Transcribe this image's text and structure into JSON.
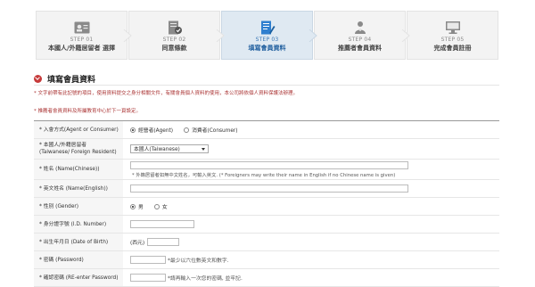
{
  "steps": [
    {
      "num": "STEP 01",
      "label": "本國人/外籍居留者  選擇",
      "icon": "id-card-icon",
      "active": false
    },
    {
      "num": "STEP 02",
      "label": "同意條款",
      "icon": "checklist-icon",
      "active": false
    },
    {
      "num": "STEP 03",
      "label": "填寫會員資料",
      "icon": "edit-form-icon",
      "active": true
    },
    {
      "num": "STEP 04",
      "label": "推薦者會員資料",
      "icon": "recommender-icon",
      "active": false
    },
    {
      "num": "STEP 05",
      "label": "完成會員註冊",
      "icon": "monitor-icon",
      "active": false
    }
  ],
  "section": {
    "title": "填寫會員資料",
    "note1": "* 文字前帶有此記號的項目，使用資料提交之身分相關文件，有關會員個人資料的使用，本公司將依個人資料保護法辦理。",
    "note2": "* 推薦者會員資料及所屬教育中心於下一頁設定。"
  },
  "form": {
    "member_type": {
      "label": "* 入會方式(Agent or Consumer)",
      "opt1": "經營者(Agent)",
      "opt2": "消費者(Consumer)"
    },
    "residency": {
      "label1": "* 本國人/外籍居留者",
      "label2": "(Taiwanese/ Foreign Resident)",
      "value": "本國人(Taiwanese)"
    },
    "name_cn": {
      "label": "* 姓名 (Name(Chinese))",
      "hint": "* 外籍居留者如無中文姓名，可輸入英文. (* Foreigners may write their name in English if no Chinese name is given)"
    },
    "name_en": {
      "label": "* 英文姓名 (Name(English))"
    },
    "gender": {
      "label": "* 性別 (Gender)",
      "opt1": "男",
      "opt2": "女"
    },
    "id_number": {
      "label": "* 身分證字號 (I.D. Number)"
    },
    "birth": {
      "label": "* 出生年月日 (Date of Birth)",
      "prefix": "(西元)"
    },
    "password": {
      "label": "* 密碼 (Password)",
      "hint": "*最少以六位數英文和數字."
    },
    "password_confirm": {
      "label": "* 確認密碼 (RE-enter Password)",
      "hint": "*請再輸入一次您的密碼, 並牢記."
    }
  }
}
